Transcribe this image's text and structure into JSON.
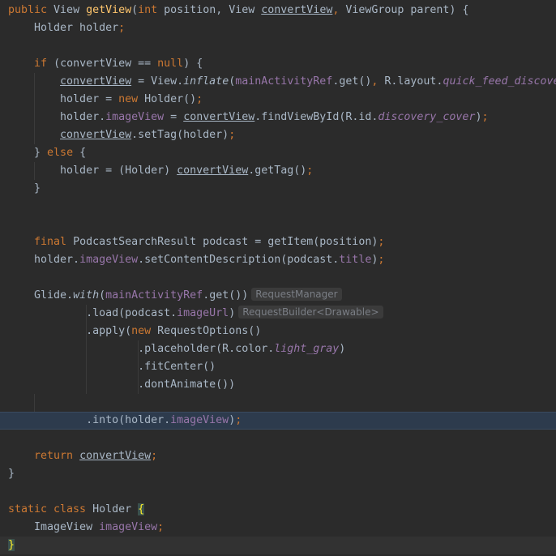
{
  "editor": {
    "language": "java",
    "lines": [
      [
        [
          "kw",
          "public "
        ],
        [
          "t",
          "View "
        ],
        [
          "fn",
          "getView"
        ],
        [
          "t",
          "("
        ],
        [
          "kw",
          "int "
        ],
        [
          "t",
          "position, View "
        ],
        [
          "ul",
          "convertView"
        ],
        [
          "kw",
          ", "
        ],
        [
          "t",
          "ViewGroup parent) {"
        ]
      ],
      [
        [
          "t",
          "    Holder holder"
        ],
        [
          "kw",
          ";"
        ]
      ],
      [],
      [
        [
          "t",
          "    "
        ],
        [
          "kw",
          "if "
        ],
        [
          "t",
          "(convertView == "
        ],
        [
          "kw",
          "null"
        ],
        [
          "t",
          ") {"
        ]
      ],
      [
        [
          "t",
          "        "
        ],
        [
          "ul",
          "convertView"
        ],
        [
          "t",
          " = View."
        ],
        [
          "sm",
          "inflate"
        ],
        [
          "t",
          "("
        ],
        [
          "fd",
          "mainActivityRef"
        ],
        [
          "t",
          ".get()"
        ],
        [
          "kw",
          ", "
        ],
        [
          "t",
          "R.layout."
        ],
        [
          "sf",
          "quick_feed_discovery"
        ]
      ],
      [
        [
          "t",
          "        holder = "
        ],
        [
          "kw",
          "new "
        ],
        [
          "t",
          "Holder()"
        ],
        [
          "kw",
          ";"
        ]
      ],
      [
        [
          "t",
          "        holder."
        ],
        [
          "fd",
          "imageView"
        ],
        [
          "t",
          " = "
        ],
        [
          "ul",
          "convertView"
        ],
        [
          "t",
          ".findViewById(R.id."
        ],
        [
          "sf",
          "discovery_cover"
        ],
        [
          "t",
          ")"
        ],
        [
          "kw",
          ";"
        ]
      ],
      [
        [
          "t",
          "        "
        ],
        [
          "ul",
          "convertView"
        ],
        [
          "t",
          ".setTag(holder)"
        ],
        [
          "kw",
          ";"
        ]
      ],
      [
        [
          "t",
          "    } "
        ],
        [
          "kw",
          "else "
        ],
        [
          "t",
          "{"
        ]
      ],
      [
        [
          "t",
          "        holder = (Holder) "
        ],
        [
          "ul",
          "convertView"
        ],
        [
          "t",
          ".getTag()"
        ],
        [
          "kw",
          ";"
        ]
      ],
      [
        [
          "t",
          "    }"
        ]
      ],
      [],
      [],
      [
        [
          "t",
          "    "
        ],
        [
          "kw",
          "final "
        ],
        [
          "t",
          "PodcastSearchResult podcast = getItem(position)"
        ],
        [
          "kw",
          ";"
        ]
      ],
      [
        [
          "t",
          "    holder."
        ],
        [
          "fd",
          "imageView"
        ],
        [
          "t",
          ".setContentDescription(podcast."
        ],
        [
          "fd",
          "title"
        ],
        [
          "t",
          ")"
        ],
        [
          "kw",
          ";"
        ]
      ],
      [],
      [
        [
          "t",
          "    Glide."
        ],
        [
          "sm",
          "with"
        ],
        [
          "t",
          "("
        ],
        [
          "fd",
          "mainActivityRef"
        ],
        [
          "t",
          ".get())"
        ],
        [
          "hint",
          "RequestManager"
        ]
      ],
      [
        [
          "t",
          "            .load(podcast."
        ],
        [
          "fd",
          "imageUrl"
        ],
        [
          "t",
          ")"
        ],
        [
          "hint",
          "RequestBuilder<Drawable>"
        ]
      ],
      [
        [
          "t",
          "            .apply("
        ],
        [
          "kw",
          "new "
        ],
        [
          "t",
          "RequestOptions()"
        ]
      ],
      [
        [
          "t",
          "                    .placeholder(R.color."
        ],
        [
          "sf",
          "light_gray"
        ],
        [
          "t",
          ")"
        ]
      ],
      [
        [
          "t",
          "                    .fitCenter()"
        ]
      ],
      [
        [
          "t",
          "                    .dontAnimate())"
        ]
      ],
      [],
      [
        [
          "t",
          "            .into(holder."
        ],
        [
          "fd",
          "imageView"
        ],
        [
          "t",
          ")"
        ],
        [
          "kw",
          ";"
        ]
      ],
      [],
      [
        [
          "t",
          "    "
        ],
        [
          "kw",
          "return "
        ],
        [
          "ul",
          "convertView"
        ],
        [
          "kw",
          ";"
        ]
      ],
      [
        [
          "t",
          "}"
        ]
      ],
      [],
      [
        [
          "kw",
          "static class "
        ],
        [
          "t",
          "Holder "
        ],
        [
          "br",
          "{"
        ]
      ],
      [
        [
          "t",
          "    ImageView "
        ],
        [
          "fd",
          "imageView"
        ],
        [
          "kw",
          ";"
        ]
      ],
      [
        [
          "br",
          "}"
        ]
      ]
    ]
  }
}
